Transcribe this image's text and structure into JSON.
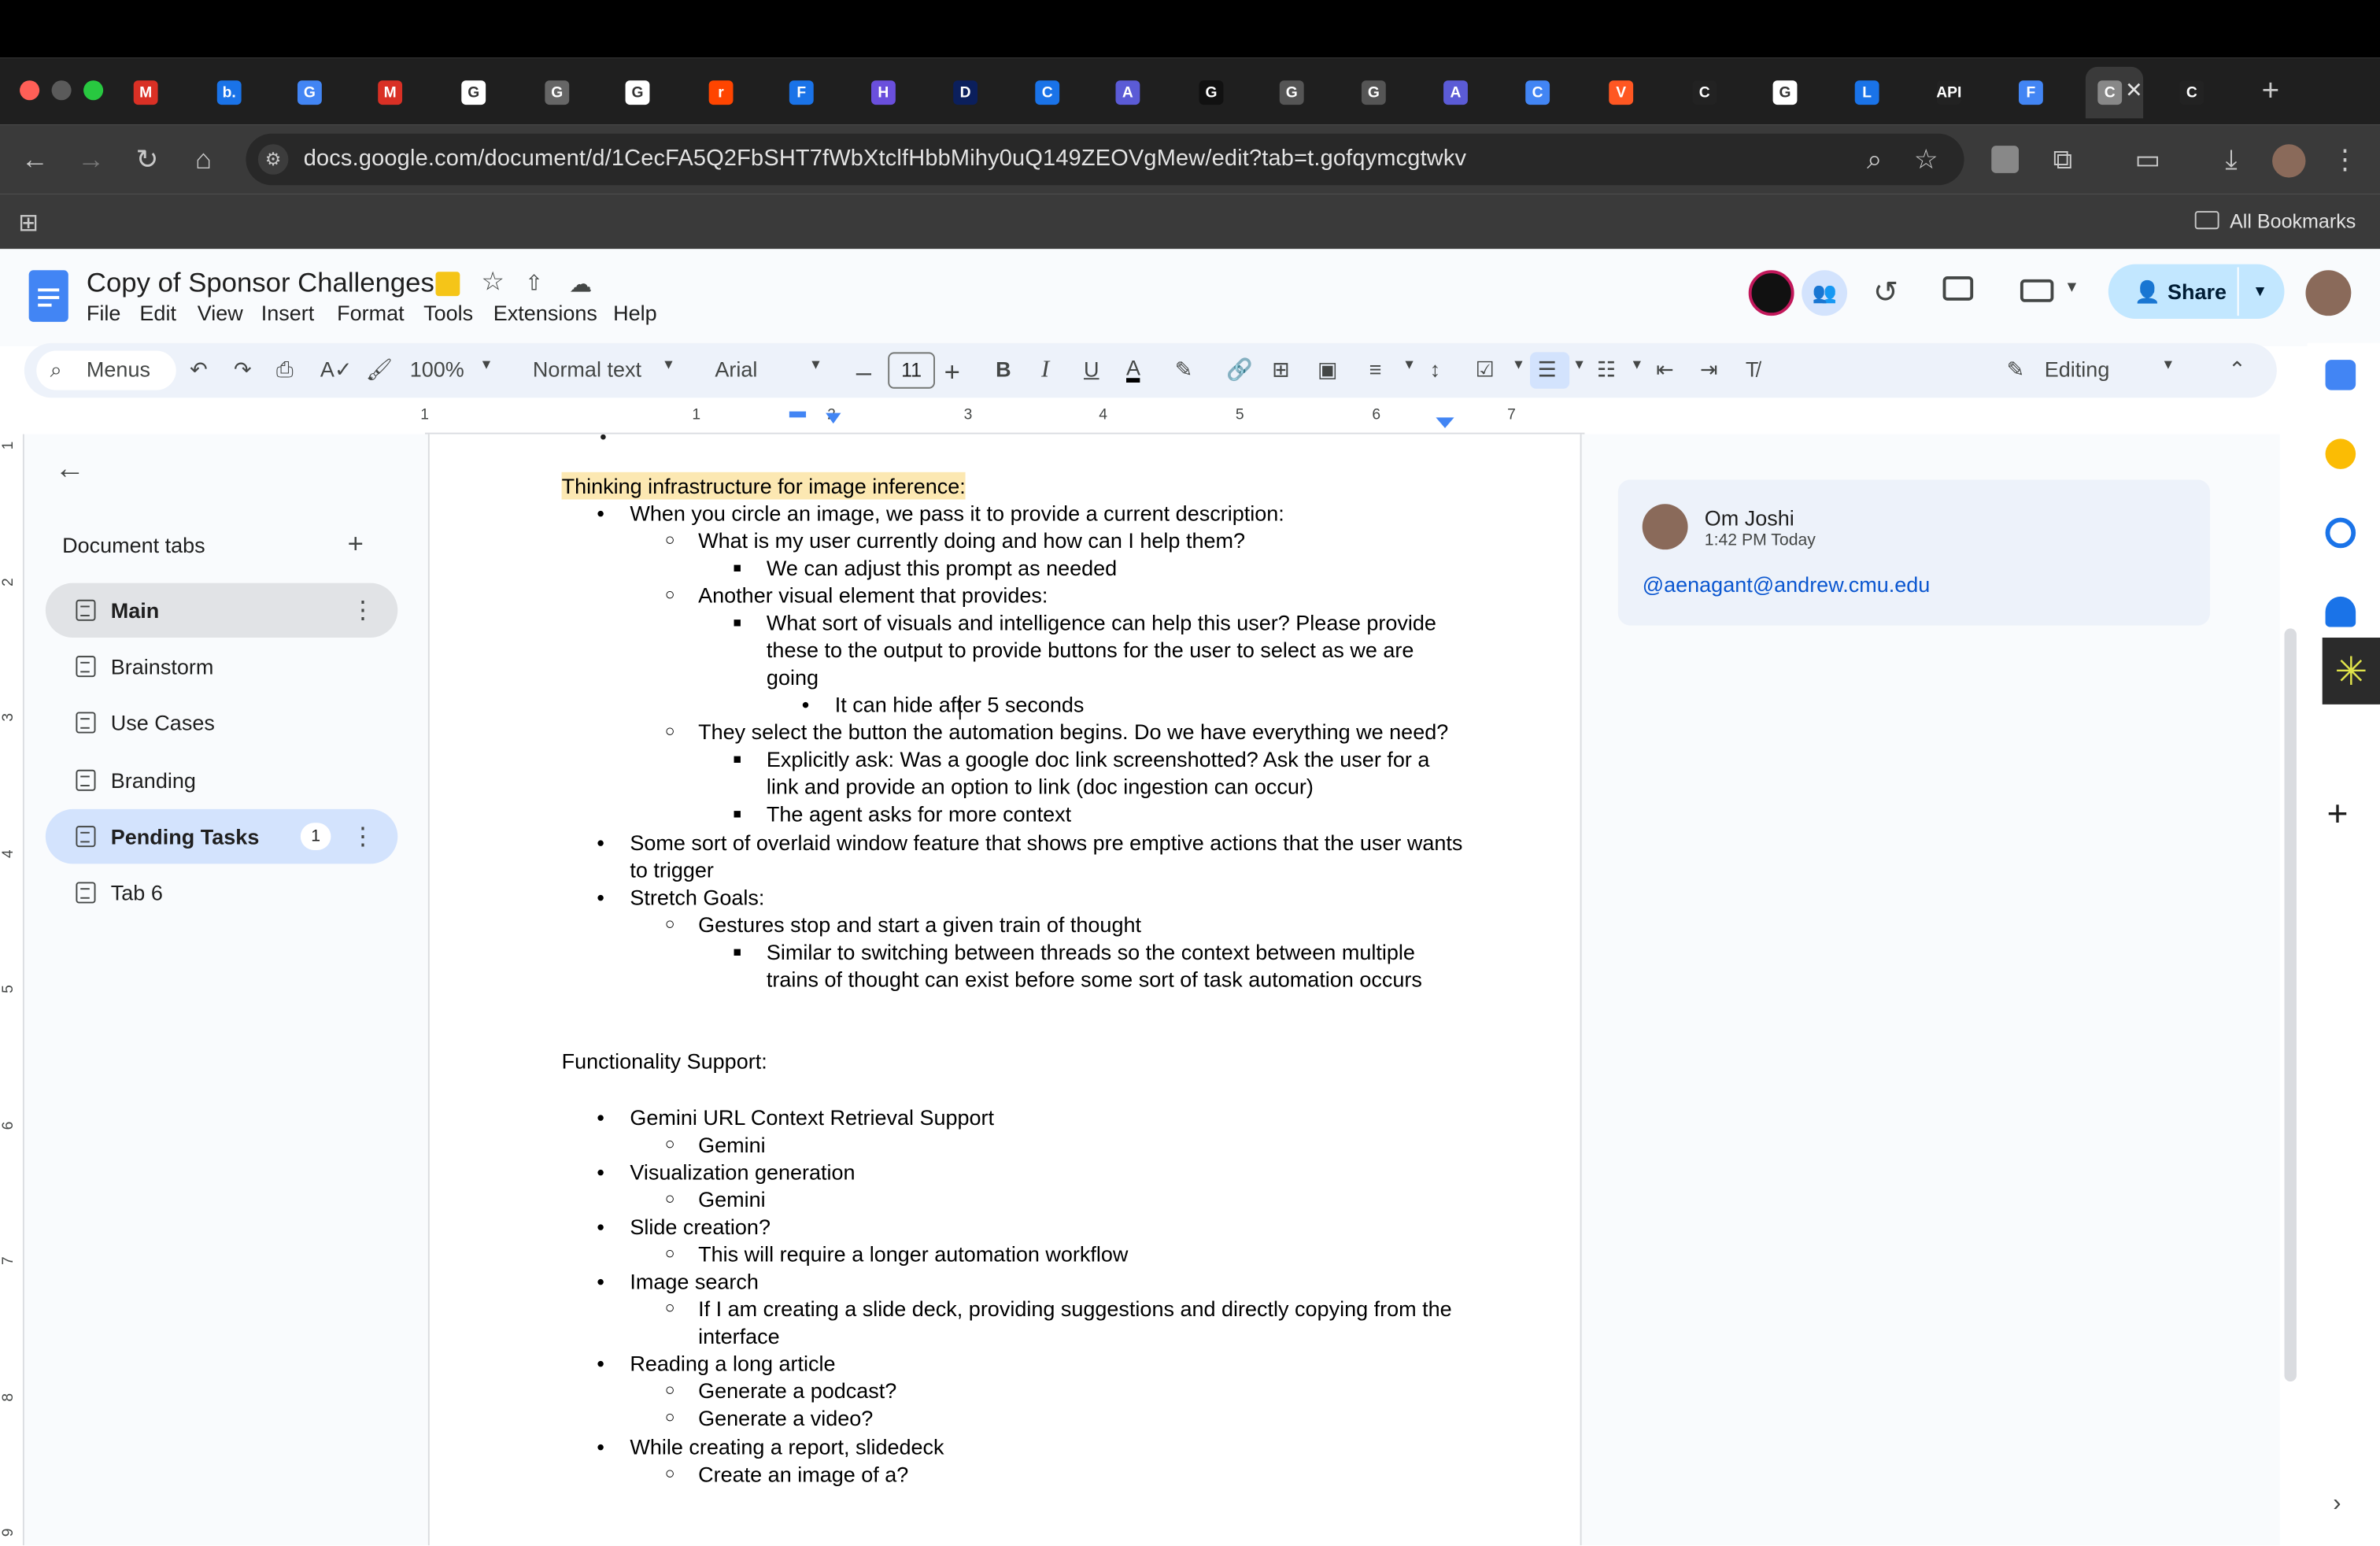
{
  "browser": {
    "tabs": [
      "M",
      "b.",
      "G",
      "M",
      "G",
      "G",
      "G",
      "r",
      "F",
      "H",
      "D",
      "C",
      "A",
      "G",
      "G",
      "G",
      "A",
      "C",
      "V",
      "C",
      "G",
      "L",
      "API",
      "F",
      "C",
      "C"
    ],
    "url": "docs.google.com/document/d/1CecFA5Q2FbSHT7fWbXtclfHbbMihy0uQ149ZEOVgMew/edit?tab=t.gofqymcgtwkv",
    "bookmarks_label": "All Bookmarks"
  },
  "doc": {
    "title": "Copy of Sponsor Challenges",
    "menus": [
      "File",
      "Edit",
      "View",
      "Insert",
      "Format",
      "Tools",
      "Extensions",
      "Help"
    ],
    "share_label": "Share"
  },
  "toolbar": {
    "menus_label": "Menus",
    "zoom": "100%",
    "style": "Normal text",
    "font": "Arial",
    "font_size": "11",
    "editing_label": "Editing"
  },
  "ruler": {
    "numbers": [
      "1",
      "1",
      "2",
      "3",
      "4",
      "5",
      "6",
      "7"
    ]
  },
  "vruler": {
    "numbers": [
      "1",
      "2",
      "3",
      "4",
      "5",
      "6",
      "7",
      "8",
      "9"
    ]
  },
  "sidebar": {
    "heading": "Document tabs",
    "tabs": [
      {
        "label": "Main"
      },
      {
        "label": "Brainstorm"
      },
      {
        "label": "Use Cases"
      },
      {
        "label": "Branding"
      },
      {
        "label": "Pending Tasks",
        "badge": "1"
      },
      {
        "label": "Tab 6"
      }
    ]
  },
  "body": {
    "lines": [
      "Thinking infrastructure for image inference:",
      "When you circle an image, we pass it to provide a current description:",
      "What is my user currently doing and how can I help them?",
      "We can adjust this prompt as needed",
      "Another visual element that provides:",
      "What sort of visuals and intelligence can help this user? Please provide",
      "these to the output to provide buttons for the user to select as we are",
      "going",
      "It can hide after 5 seconds",
      "They select the button the automation begins. Do we have everything we need?",
      "Explicitly ask: Was a google doc link screenshotted? Ask the user for a",
      "link and provide an option to link (doc ingestion can occur)",
      "The agent asks for more context",
      "Some sort of overlaid window feature that shows pre emptive actions that the user wants",
      "to trigger",
      "Stretch Goals:",
      "Gestures stop and start a given train of thought",
      "Similar to switching between threads so the context between multiple",
      "trains of thought can exist before some sort of task automation occurs",
      "Functionality Support:",
      "Gemini URL Context Retrieval Support",
      "Gemini",
      "Visualization generation",
      "Gemini",
      "Slide creation?",
      "This will require a longer automation workflow",
      "Image search",
      "If I am creating a slide deck, providing suggestions and directly copying from the",
      "interface",
      "Reading a long article",
      "Generate a podcast?",
      "Generate a video?",
      "While creating a report, slidedeck",
      "Create an image of a?"
    ]
  },
  "comment": {
    "author": "Om Joshi",
    "time": "1:42 PM Today",
    "text": "@aenagant@andrew.cmu.edu"
  },
  "colors": {
    "accent": "#0b57d0",
    "highlight": "#fce8b2",
    "share_bg": "#c2e7ff"
  }
}
